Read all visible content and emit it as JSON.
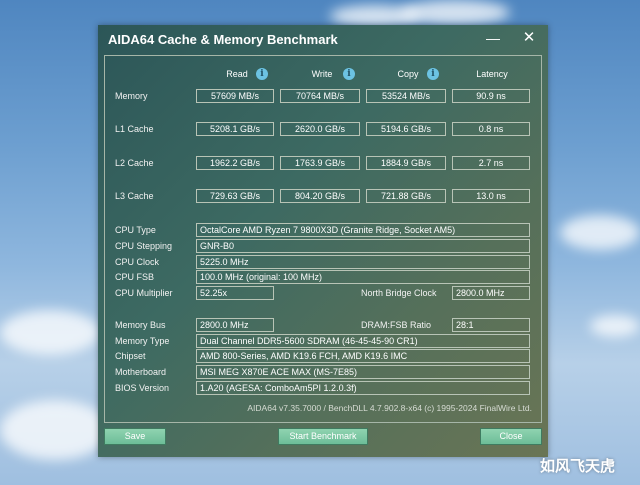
{
  "window": {
    "title": "AIDA64 Cache & Memory Benchmark",
    "minimize_icon": "minimize-icon",
    "close_icon": "close-icon"
  },
  "columns": {
    "read": "Read",
    "write": "Write",
    "copy": "Copy",
    "latency": "Latency"
  },
  "rows": {
    "memory": {
      "label": "Memory",
      "read": "57609 MB/s",
      "write": "70764 MB/s",
      "copy": "53524 MB/s",
      "latency": "90.9 ns"
    },
    "l1": {
      "label": "L1 Cache",
      "read": "5208.1 GB/s",
      "write": "2620.0 GB/s",
      "copy": "5194.6 GB/s",
      "latency": "0.8 ns"
    },
    "l2": {
      "label": "L2 Cache",
      "read": "1962.2 GB/s",
      "write": "1763.9 GB/s",
      "copy": "1884.9 GB/s",
      "latency": "2.7 ns"
    },
    "l3": {
      "label": "L3 Cache",
      "read": "729.63 GB/s",
      "write": "804.20 GB/s",
      "copy": "721.88 GB/s",
      "latency": "13.0 ns"
    }
  },
  "cpu": {
    "type_label": "CPU Type",
    "type": "OctalCore AMD Ryzen 7 9800X3D  (Granite Ridge, Socket AM5)",
    "stepping_label": "CPU Stepping",
    "stepping": "GNR-B0",
    "clock_label": "CPU Clock",
    "clock": "5225.0 MHz",
    "fsb_label": "CPU FSB",
    "fsb": "100.0 MHz  (original: 100 MHz)",
    "multiplier_label": "CPU Multiplier",
    "multiplier": "52.25x",
    "nb_clock_label": "North Bridge Clock",
    "nb_clock": "2800.0 MHz"
  },
  "memory_info": {
    "bus_label": "Memory Bus",
    "bus": "2800.0 MHz",
    "ratio_label": "DRAM:FSB Ratio",
    "ratio": "28:1",
    "type_label": "Memory Type",
    "type": "Dual Channel DDR5-5600 SDRAM  (46-45-45-90 CR1)",
    "chipset_label": "Chipset",
    "chipset": "AMD 800-Series, AMD K19.6 FCH, AMD K19.6 IMC",
    "motherboard_label": "Motherboard",
    "motherboard": "MSI MEG X870E ACE MAX (MS-7E85)",
    "bios_label": "BIOS Version",
    "bios": "1.A20  (AGESA: ComboAm5PI 1.2.0.3f)"
  },
  "footer": "AIDA64 v7.35.7000 / BenchDLL 4.7.902.8-x64  (c) 1995-2024 FinalWire Ltd.",
  "buttons": {
    "save": "Save",
    "start": "Start Benchmark",
    "close": "Close"
  },
  "watermark": "如风飞天虎"
}
